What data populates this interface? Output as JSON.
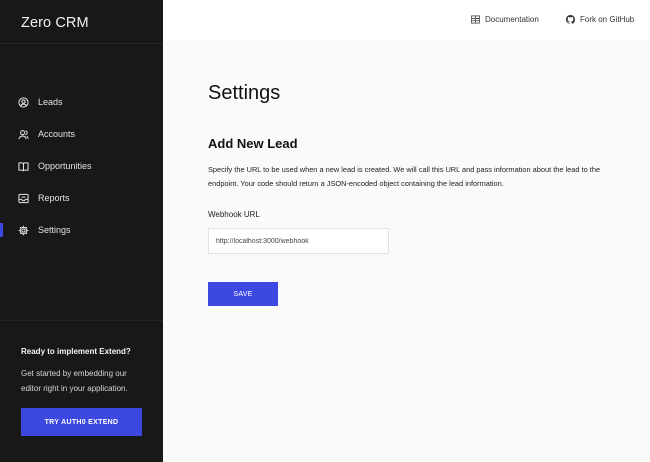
{
  "app": {
    "title": "Zero CRM"
  },
  "sidebar": {
    "items": [
      {
        "label": "Leads",
        "icon": "user-circle-icon",
        "active": false
      },
      {
        "label": "Accounts",
        "icon": "users-icon",
        "active": false
      },
      {
        "label": "Opportunities",
        "icon": "book-icon",
        "active": false
      },
      {
        "label": "Reports",
        "icon": "inbox-icon",
        "active": false
      },
      {
        "label": "Settings",
        "icon": "gear-icon",
        "active": true
      }
    ],
    "promo": {
      "title": "Ready to implement Extend?",
      "text": "Get started by embedding our editor right in your application.",
      "button_label": "TRY AUTH0 EXTEND"
    }
  },
  "header": {
    "documentation_label": "Documentation",
    "documentation_icon": "book-grid-icon",
    "github_label": "Fork on GitHub",
    "github_icon": "github-icon"
  },
  "main": {
    "page_title": "Settings",
    "section_title": "Add New Lead",
    "description": "Specify the URL to be used when a new lead is created. We will call this URL and pass information about the lead to the endpoint. Your code should return a JSON-encoded object containing the lead information.",
    "webhook_label": "Webhook URL",
    "webhook_value": "http://localhost:3000/webhook",
    "save_label": "SAVE"
  },
  "colors": {
    "accent": "#3c48e0",
    "sidebar_bg": "#181818",
    "content_bg": "#fafafa"
  }
}
